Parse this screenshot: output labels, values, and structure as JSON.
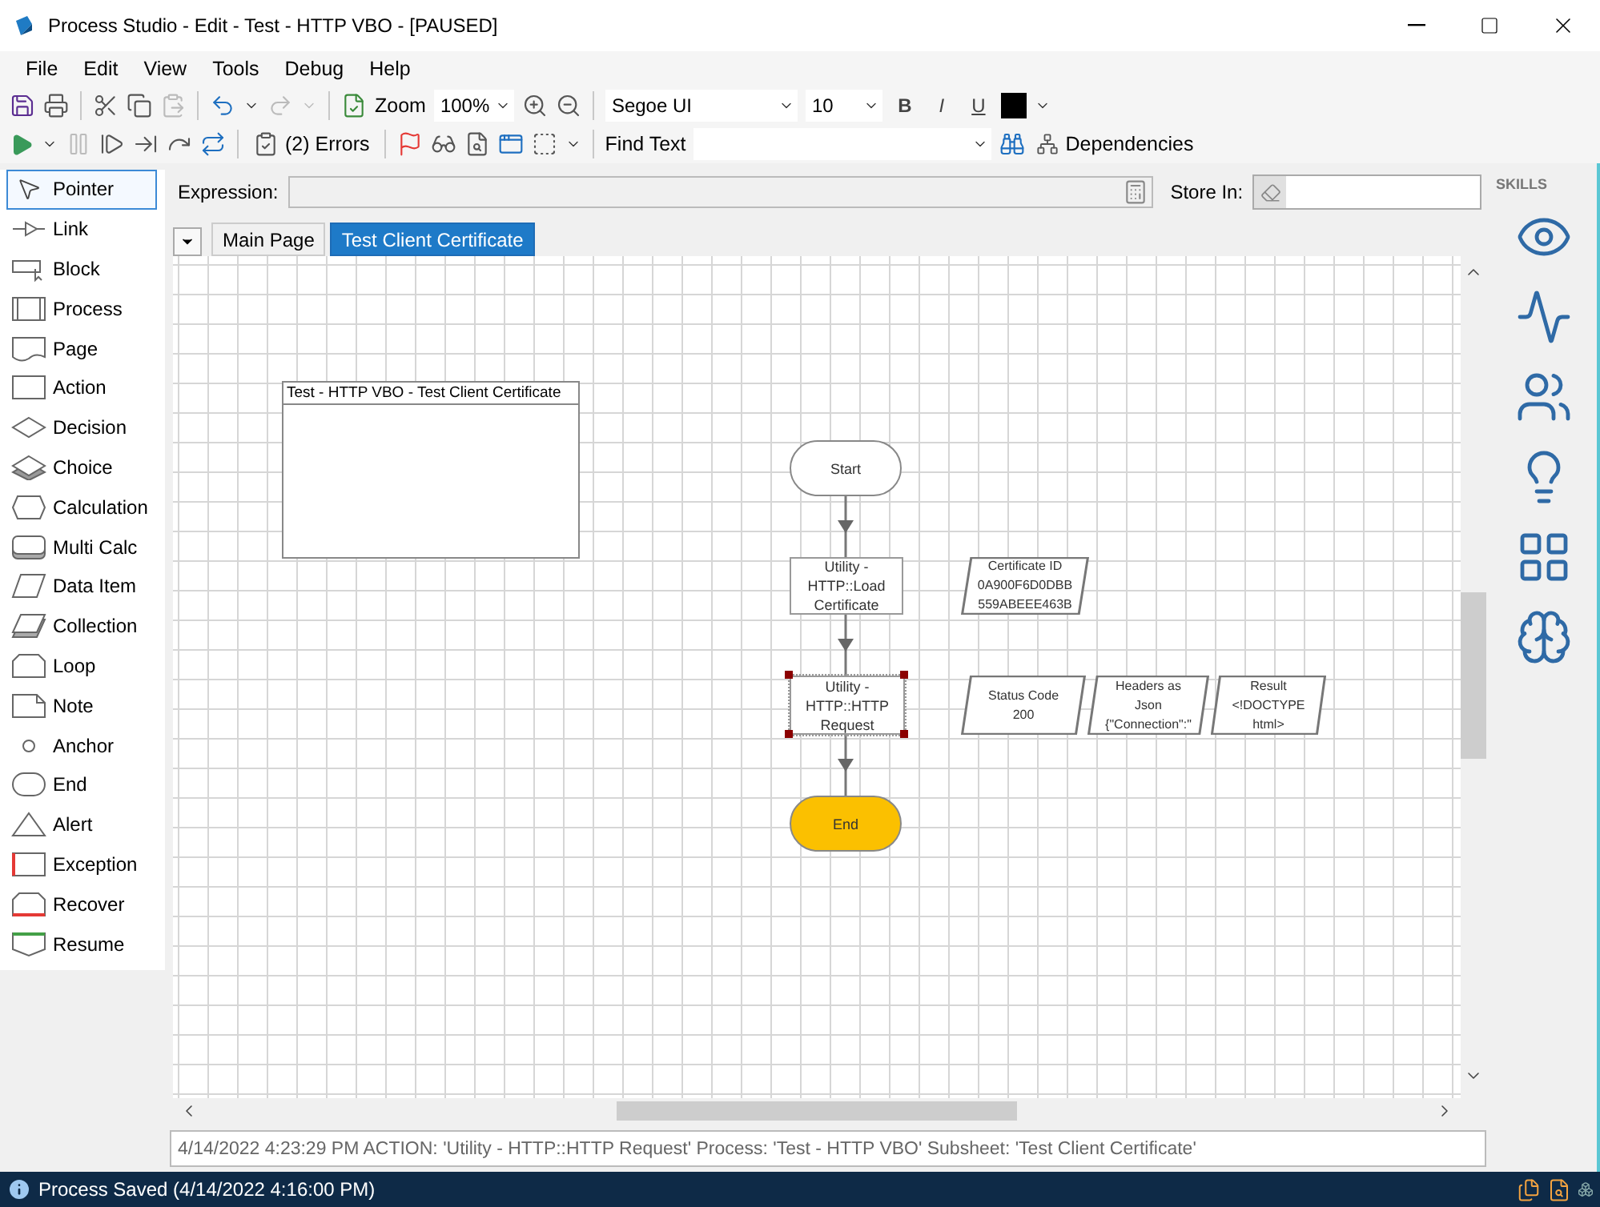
{
  "window": {
    "title": "Process Studio  - Edit - Test - HTTP VBO - [PAUSED]"
  },
  "menu": [
    "File",
    "Edit",
    "View",
    "Tools",
    "Debug",
    "Help"
  ],
  "toolbar": {
    "zoom_label": "Zoom",
    "zoom_value": "100%",
    "font": "Segoe UI",
    "font_size": "10",
    "bold": "B",
    "italic": "I",
    "underline": "U"
  },
  "debug_toolbar": {
    "errors": "(2) Errors",
    "find_label": "Find Text",
    "dependencies": "Dependencies"
  },
  "palette": [
    {
      "label": "Pointer",
      "selected": true
    },
    {
      "label": "Link",
      "selected": false
    },
    {
      "label": "Block",
      "selected": false
    },
    {
      "label": "Process",
      "selected": false
    },
    {
      "label": "Page",
      "selected": false
    },
    {
      "label": "Action",
      "selected": false
    },
    {
      "label": "Decision",
      "selected": false
    },
    {
      "label": "Choice",
      "selected": false
    },
    {
      "label": "Calculation",
      "selected": false
    },
    {
      "label": "Multi Calc",
      "selected": false
    },
    {
      "label": "Data Item",
      "selected": false
    },
    {
      "label": "Collection",
      "selected": false
    },
    {
      "label": "Loop",
      "selected": false
    },
    {
      "label": "Note",
      "selected": false
    },
    {
      "label": "Anchor",
      "selected": false
    },
    {
      "label": "End",
      "selected": false
    },
    {
      "label": "Alert",
      "selected": false
    },
    {
      "label": "Exception",
      "selected": false
    },
    {
      "label": "Recover",
      "selected": false
    },
    {
      "label": "Resume",
      "selected": false
    }
  ],
  "expression": {
    "label": "Expression:"
  },
  "store_in": {
    "label": "Store In:"
  },
  "tabs": [
    {
      "label": "Main Page",
      "selected": false
    },
    {
      "label": "Test Client Certificate",
      "selected": true
    }
  ],
  "diagram": {
    "block": {
      "title": "Test - HTTP VBO - Test Client Certificate"
    },
    "nodes": [
      {
        "kind": "start",
        "lines": [
          "Start"
        ],
        "selected": false
      },
      {
        "kind": "action",
        "lines": [
          "Utility -",
          "HTTP::Load",
          "Certificate"
        ],
        "selected": false
      },
      {
        "kind": "action",
        "lines": [
          "Utility -",
          "HTTP::HTTP",
          "Request"
        ],
        "selected": true
      },
      {
        "kind": "end",
        "lines": [
          "End"
        ],
        "selected": false
      },
      {
        "kind": "data",
        "lines": [
          "Certificate ID",
          "0A900F6D0DBB",
          "559ABEEE463B"
        ],
        "selected": false
      },
      {
        "kind": "data",
        "lines": [
          "Status Code",
          "200"
        ],
        "selected": false
      },
      {
        "kind": "data",
        "lines": [
          "Headers as",
          "Json",
          "{\"Connection\":\""
        ],
        "selected": false
      },
      {
        "kind": "data",
        "lines": [
          "Result",
          "<!DOCTYPE",
          "html>"
        ],
        "selected": false
      }
    ]
  },
  "log": "4/14/2022 4:23:29 PM ACTION: 'Utility - HTTP::HTTP Request' Process: 'Test - HTTP VBO' Subsheet: 'Test Client Certificate'",
  "status": "Process Saved (4/14/2022 4:16:00 PM)",
  "skills": {
    "title": "SKILLS"
  }
}
